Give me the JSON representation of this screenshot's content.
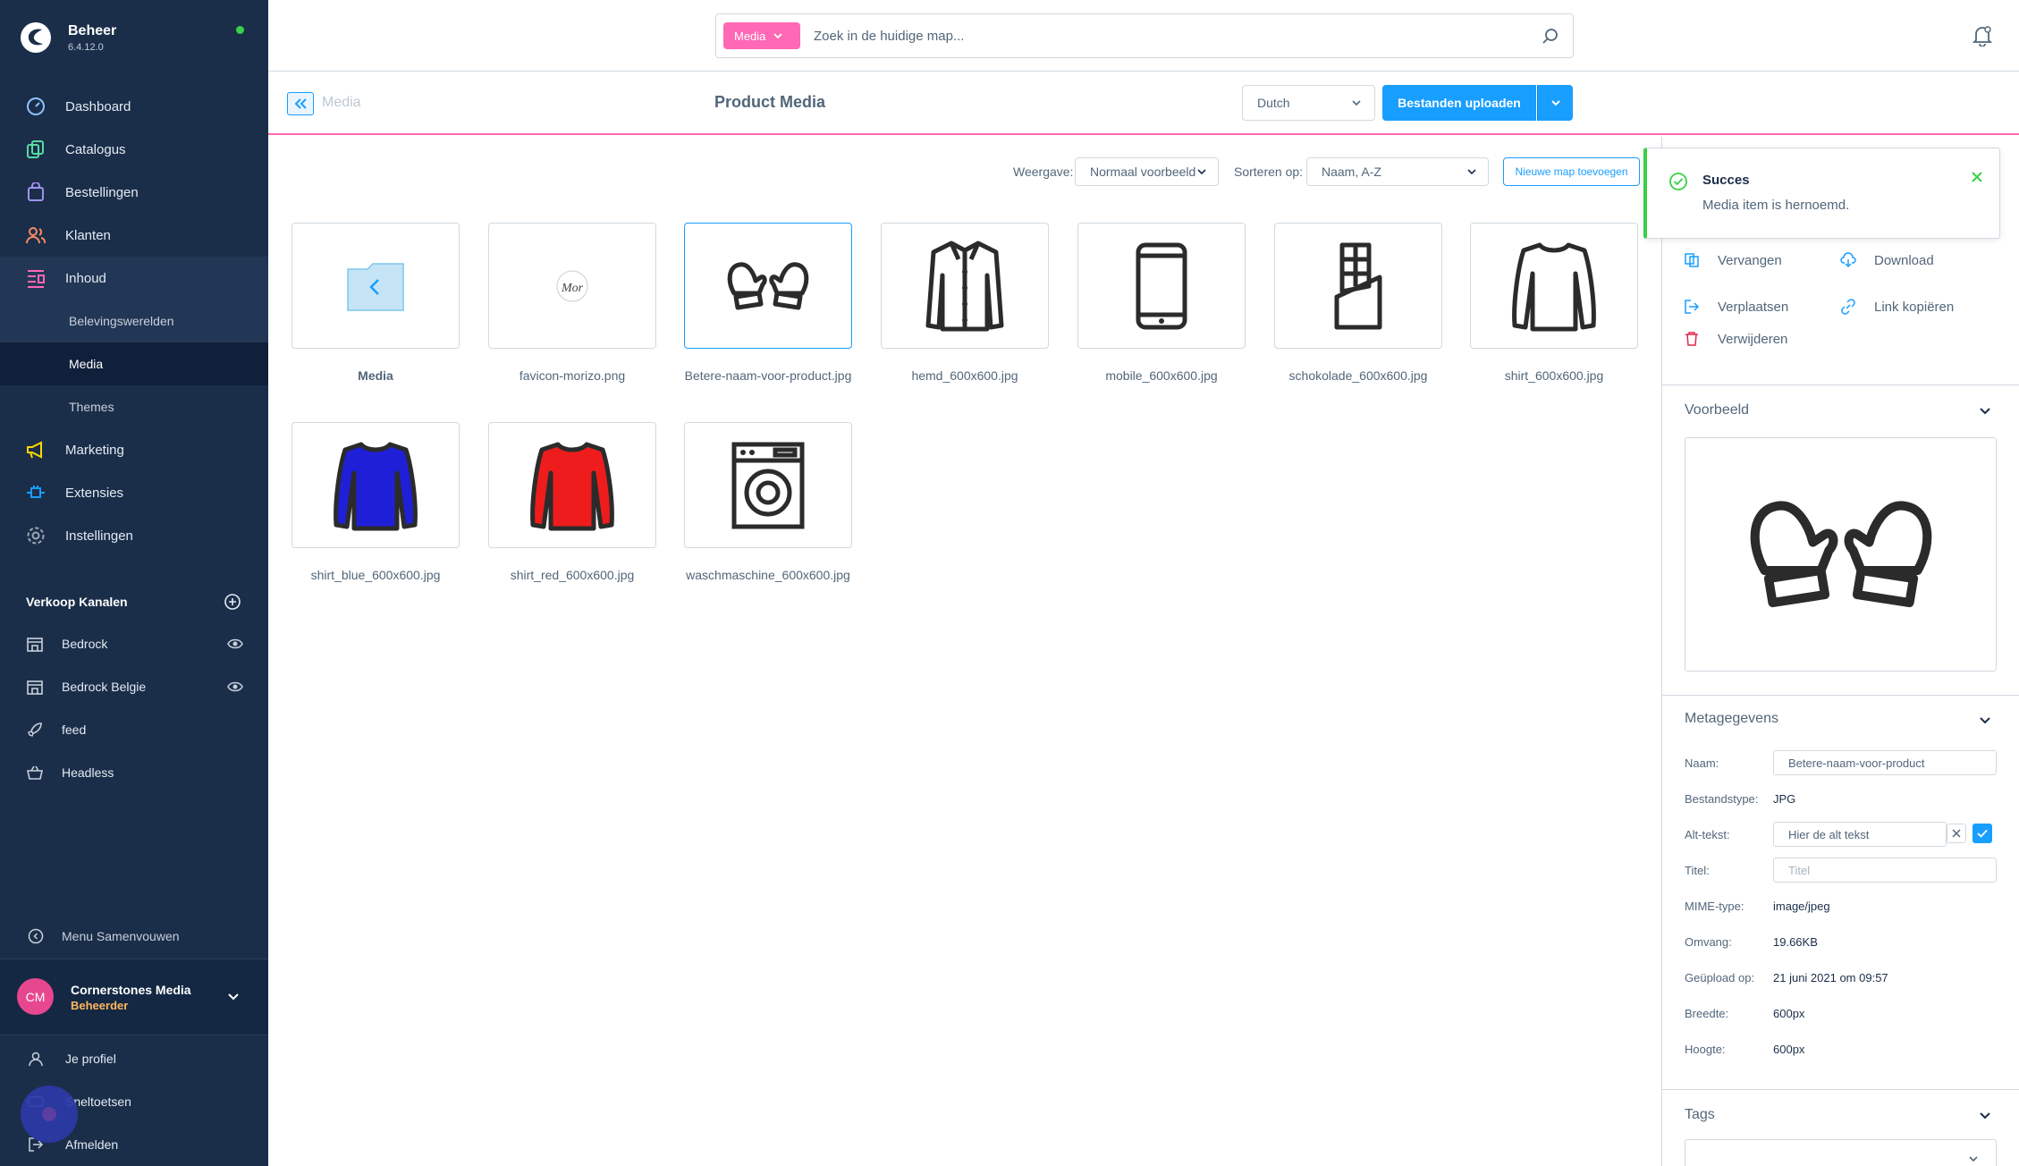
{
  "brand": {
    "name": "Beheer",
    "version": "6.4.12.0"
  },
  "nav": [
    {
      "label": "Dashboard",
      "icon": "dashboard-icon"
    },
    {
      "label": "Catalogus",
      "icon": "catalog-icon"
    },
    {
      "label": "Bestellingen",
      "icon": "shopping-bag-icon"
    },
    {
      "label": "Klanten",
      "icon": "users-icon"
    },
    {
      "label": "Inhoud",
      "icon": "content-icon"
    },
    {
      "label": "Marketing",
      "icon": "megaphone-icon"
    },
    {
      "label": "Extensies",
      "icon": "plug-icon"
    },
    {
      "label": "Instellingen",
      "icon": "gear-icon"
    }
  ],
  "nav_sub": [
    "Belevingswerelden",
    "Media",
    "Themes"
  ],
  "sales_channels": {
    "title": "Verkoop Kanalen",
    "items": [
      {
        "label": "Bedrock",
        "icon": "storefront-icon"
      },
      {
        "label": "Bedrock Belgie",
        "icon": "storefront-icon"
      },
      {
        "label": "feed",
        "icon": "rocket-icon"
      },
      {
        "label": "Headless",
        "icon": "basket-icon"
      }
    ]
  },
  "collapse_label": "Menu Samenvouwen",
  "user": {
    "initials": "CM",
    "name": "Cornerstones Media",
    "role": "Beheerder"
  },
  "footer": [
    "Je profiel",
    "Sneltoetsen",
    "Afmelden"
  ],
  "search": {
    "pill": "Media",
    "placeholder": "Zoek in de huidige map..."
  },
  "smartbar": {
    "back_label": "Media",
    "title": "Product Media",
    "language": "Dutch",
    "upload_label": "Bestanden uploaden"
  },
  "toolbar": {
    "view_label": "Weergave:",
    "view_value": "Normaal voorbeeld",
    "sort_label": "Sorteren op:",
    "sort_value": "Naam, A-Z",
    "new_folder": "Nieuwe map toevoegen"
  },
  "media_items": [
    {
      "name": "Media",
      "icon": "folder-back-icon"
    },
    {
      "name": "favicon-morizo.png",
      "icon": "morizo-logo-icon"
    },
    {
      "name": "Betere-naam-voor-product.jpg",
      "icon": "mittens-icon"
    },
    {
      "name": "hemd_600x600.jpg",
      "icon": "jacket-icon"
    },
    {
      "name": "mobile_600x600.jpg",
      "icon": "mobile-phone-icon"
    },
    {
      "name": "schokolade_600x600.jpg",
      "icon": "chocolate-icon"
    },
    {
      "name": "shirt_600x600.jpg",
      "icon": "shirt-icon"
    },
    {
      "name": "shirt_blue_600x600.jpg",
      "icon": "blue-shirt-icon"
    },
    {
      "name": "shirt_red_600x600.jpg",
      "icon": "red-shirt-icon"
    },
    {
      "name": "waschmaschine_600x600.jpg",
      "icon": "washing-machine-icon"
    }
  ],
  "morizo_text": "Mor",
  "toast": {
    "title": "Succes",
    "message": "Media item is hernoemd."
  },
  "actions": {
    "replace": "Vervangen",
    "download": "Download",
    "move": "Verplaatsen",
    "copy_link": "Link kopiëren",
    "delete": "Verwijderen"
  },
  "preview": {
    "title": "Voorbeeld"
  },
  "metadata": {
    "title": "Metagegevens",
    "name_label": "Naam:",
    "name_value": "Betere-naam-voor-product",
    "filetype_label": "Bestandstype:",
    "filetype_value": "JPG",
    "alt_label": "Alt-tekst:",
    "alt_value": "Hier de alt tekst",
    "title_label": "Titel:",
    "title_placeholder": "Titel",
    "mime_label": "MIME-type:",
    "mime_value": "image/jpeg",
    "size_label": "Omvang:",
    "size_value": "19.66KB",
    "uploaded_label": "Geüpload op:",
    "uploaded_value": "21 juni 2021 om 09:57",
    "width_label": "Breedte:",
    "width_value": "600px",
    "height_label": "Hoogte:",
    "height_value": "600px"
  },
  "tags": {
    "title": "Tags"
  },
  "colors": {
    "sidebar": "#1b2e49",
    "accent": "#189eff",
    "pink": "#ff68b4",
    "success": "#37d046",
    "avatar": "#e7478f"
  }
}
